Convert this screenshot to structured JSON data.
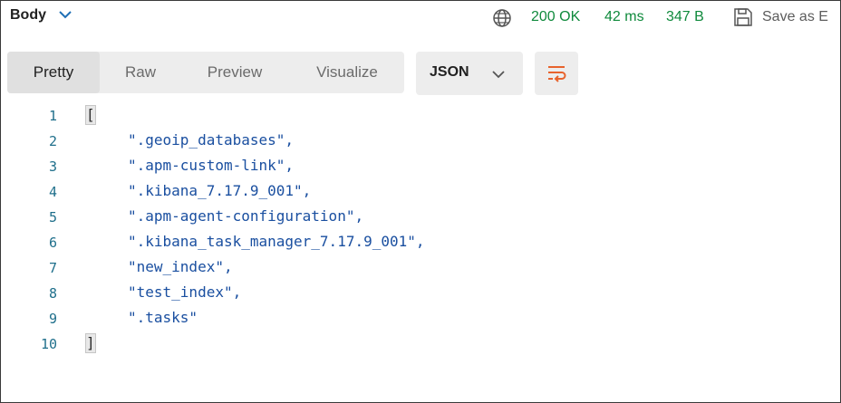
{
  "response": {
    "body_label": "Body",
    "status": "200 OK",
    "time": "42 ms",
    "size": "347 B",
    "save_label": "Save as E"
  },
  "view_tabs": {
    "pretty": "Pretty",
    "raw": "Raw",
    "preview": "Preview",
    "visualize": "Visualize",
    "active": "Pretty"
  },
  "format": {
    "selected": "JSON"
  },
  "code": {
    "line_numbers": [
      "1",
      "2",
      "3",
      "4",
      "5",
      "6",
      "7",
      "8",
      "9",
      "10"
    ],
    "open_bracket": "[",
    "close_bracket": "]",
    "items": [
      "\".geoip_databases\",",
      "\".apm-custom-link\",",
      "\".kibana_7.17.9_001\",",
      "\".apm-agent-configuration\",",
      "\".kibana_task_manager_7.17.9_001\",",
      "\"new_index\",",
      "\"test_index\",",
      "\".tasks\""
    ]
  },
  "colors": {
    "status_green": "#0f8a3c",
    "accent_orange": "#e8622c",
    "code_string": "#1a4fa0",
    "line_number": "#1f6f8b"
  },
  "icons": {
    "body_dropdown": "chevron-down-icon",
    "network": "globe-icon",
    "save": "save-icon",
    "format_dropdown": "chevron-down-icon",
    "wrap": "wrap-lines-icon"
  }
}
